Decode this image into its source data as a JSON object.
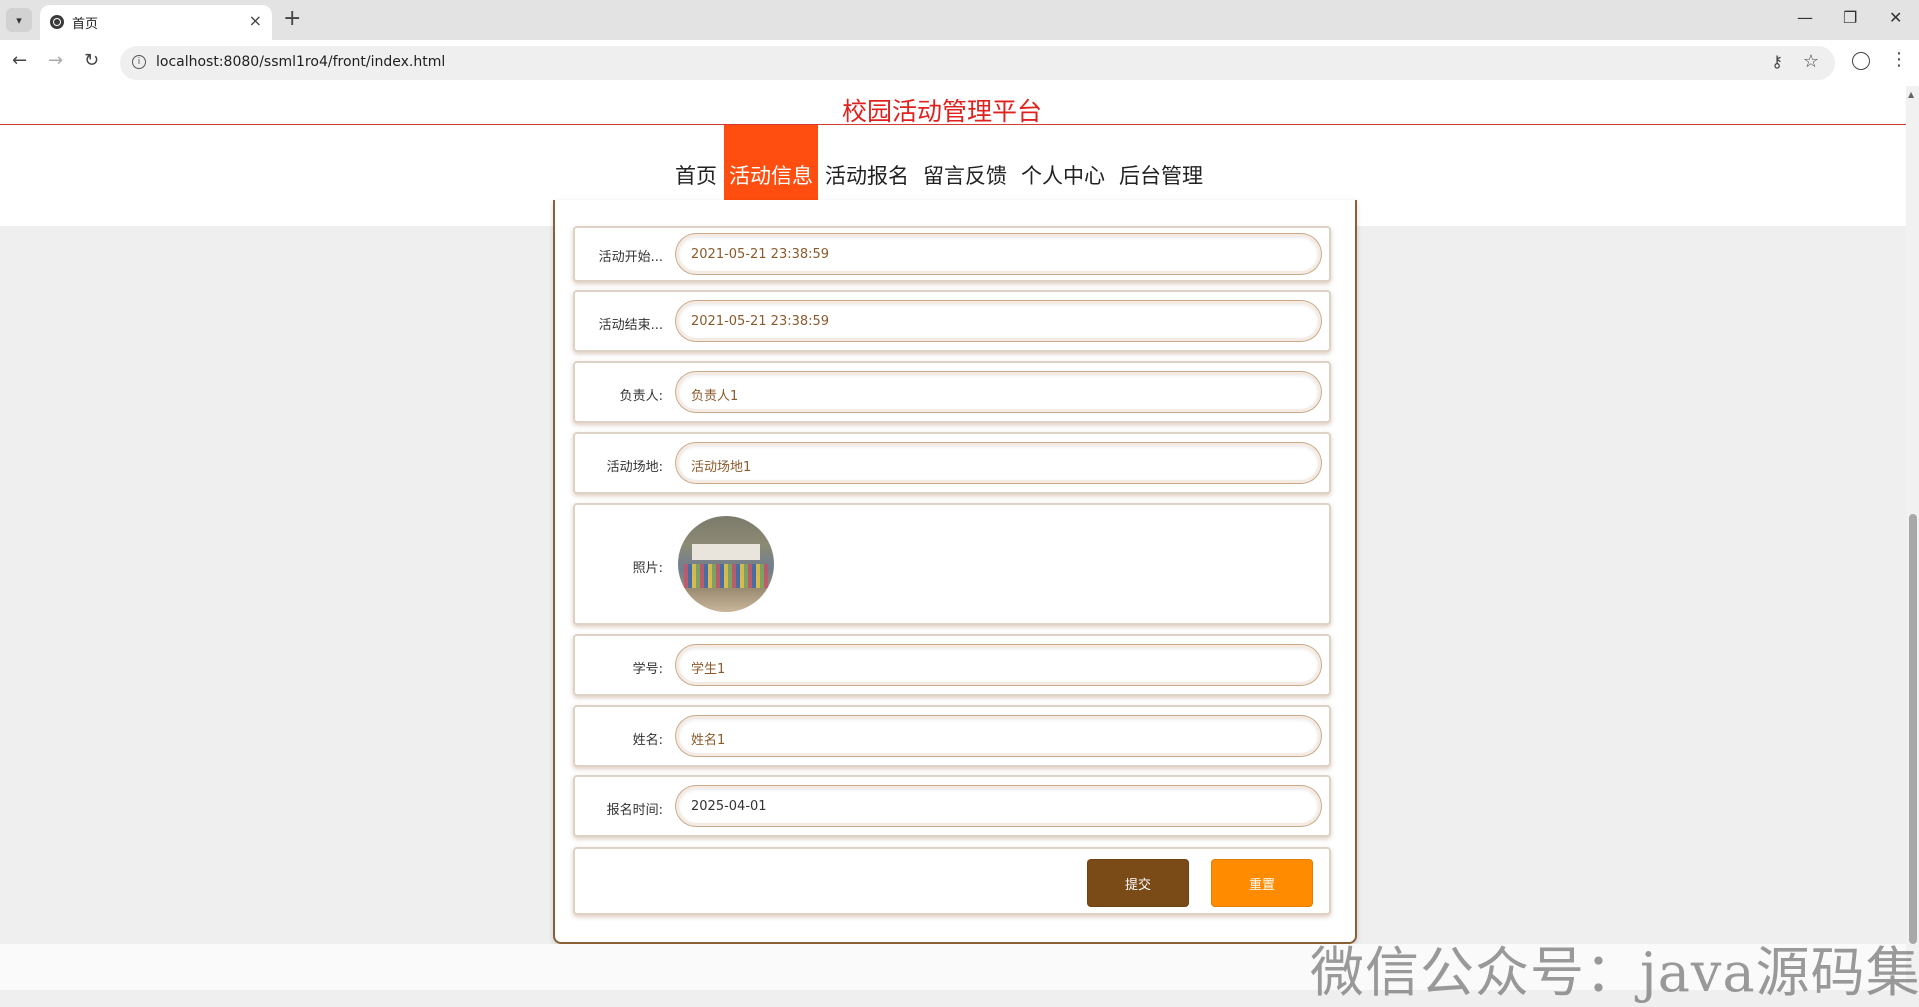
{
  "browser": {
    "tab_title": "首页",
    "url": "localhost:8080/ssml1ro4/front/index.html"
  },
  "site": {
    "title": "校园活动管理平台",
    "nav": [
      "首页",
      "活动信息",
      "活动报名",
      "留言反馈",
      "个人中心",
      "后台管理"
    ],
    "active_nav": "活动信息"
  },
  "form": {
    "start_label": "活动开始...",
    "start_value": "2021-05-21 23:38:59",
    "end_label": "活动结束...",
    "end_value": "2021-05-21 23:38:59",
    "owner_label": "负责人:",
    "owner_value": "负责人1",
    "venue_label": "活动场地:",
    "venue_value": "活动场地1",
    "photo_label": "照片:",
    "student_no_label": "学号:",
    "student_no_value": "学生1",
    "name_label": "姓名:",
    "name_value": "姓名1",
    "signup_time_label": "报名时间:",
    "signup_time_value": "2025-04-01",
    "submit_label": "提交",
    "reset_label": "重置"
  },
  "watermark": "微信公众号：java源码集合",
  "colors": {
    "title_red": "#e0221f",
    "nav_active": "#ff4e0f",
    "submit": "#7a4a17",
    "reset": "#ff8c00",
    "value_brown": "#8b5a2b"
  }
}
